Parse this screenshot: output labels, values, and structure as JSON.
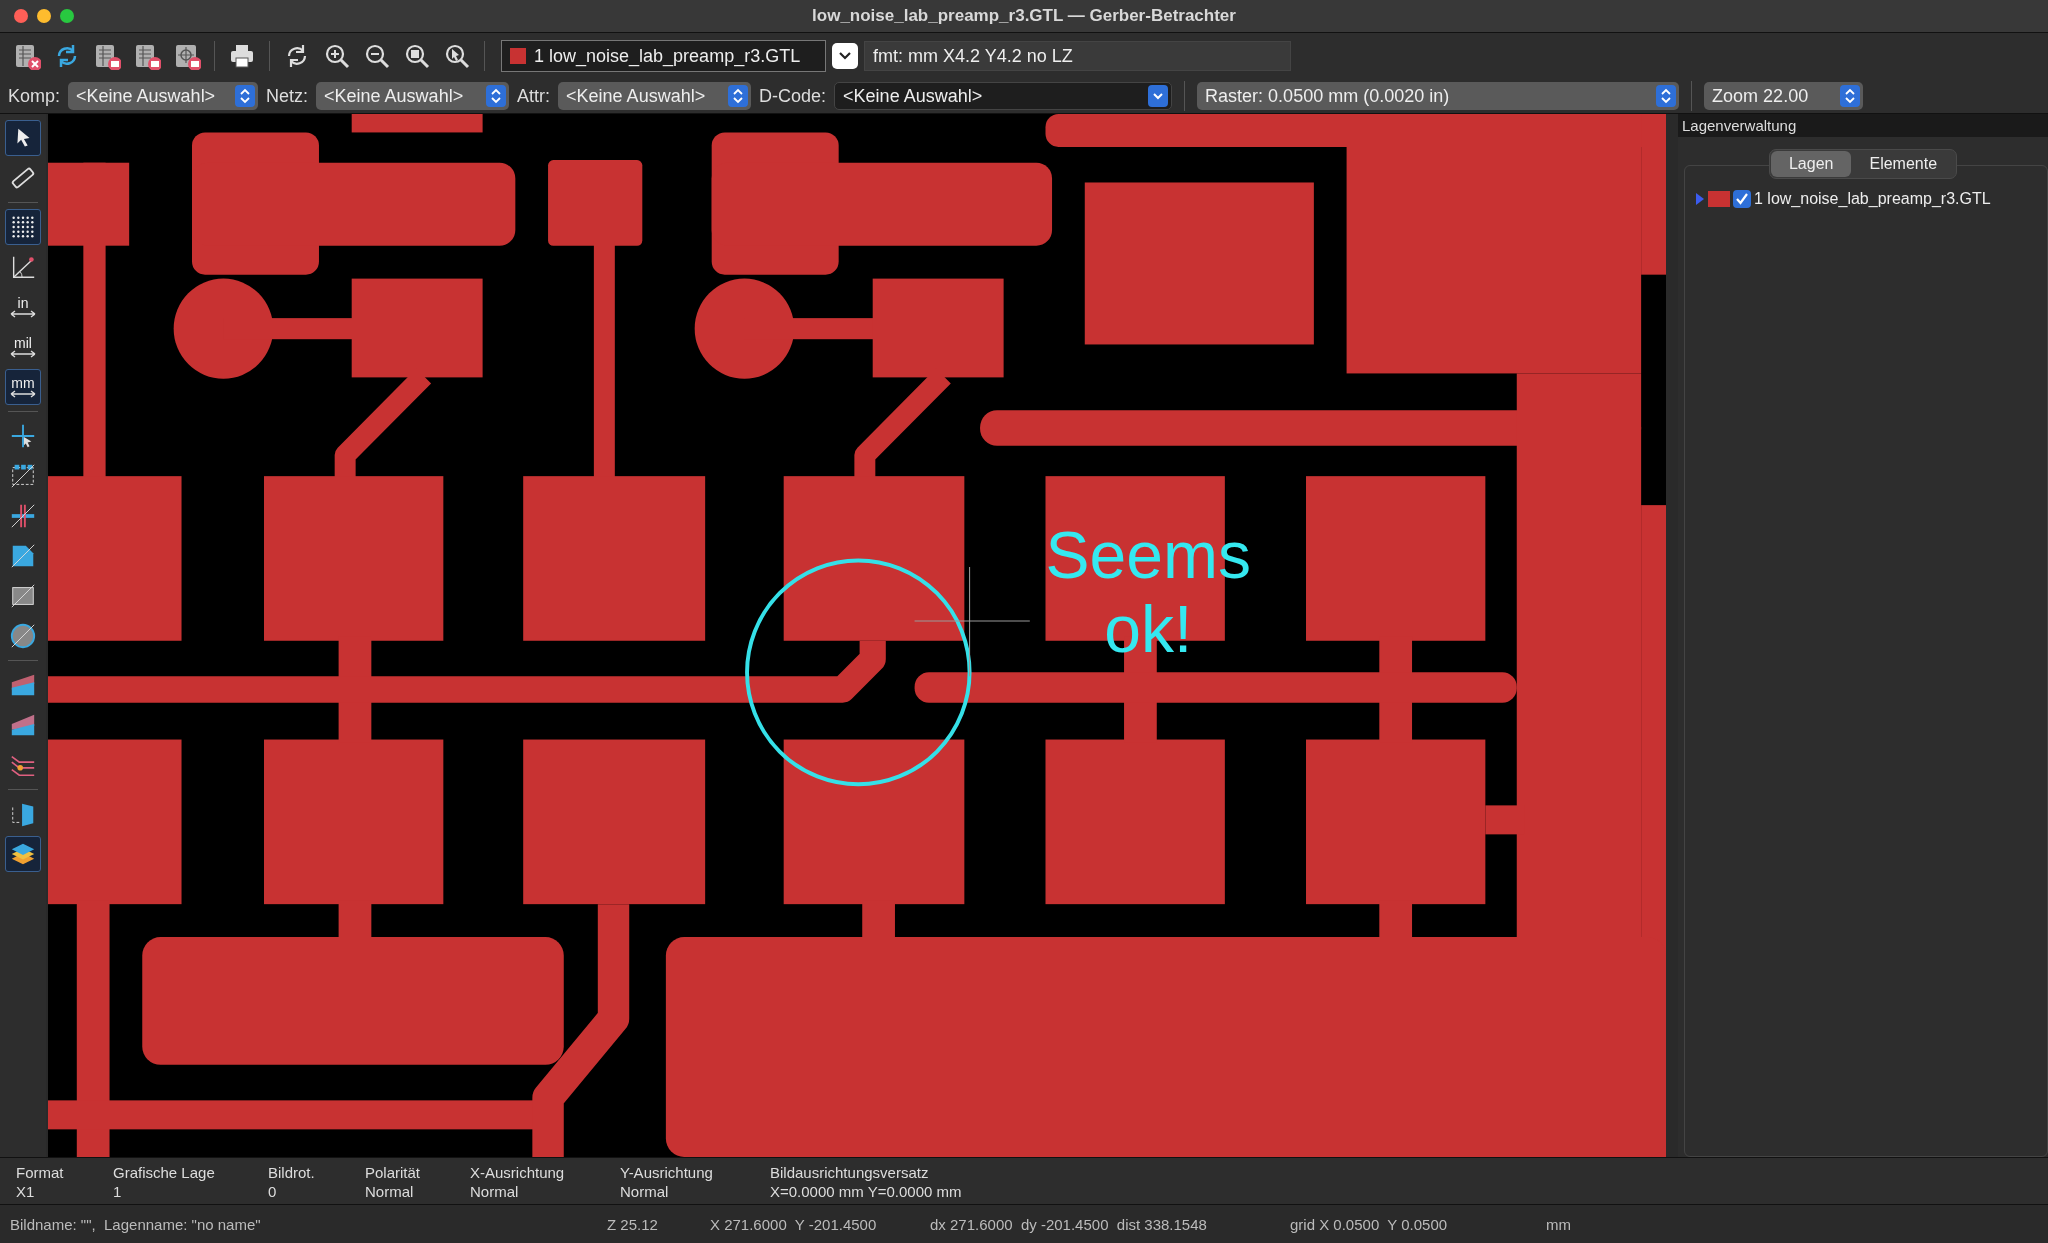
{
  "window": {
    "title": "low_noise_lab_preamp_r3.GTL — Gerber-Betrachter"
  },
  "toolbar": {
    "layer_select": "1 low_noise_lab_preamp_r3.GTL",
    "format": "fmt: mm X4.2 Y4.2 no LZ"
  },
  "filters": [
    {
      "label": "Komp:",
      "value": "<Keine Auswahl>"
    },
    {
      "label": "Netz:",
      "value": "<Keine Auswahl>"
    },
    {
      "label": "Attr:",
      "value": "<Keine Auswahl>"
    },
    {
      "label": "D-Code:",
      "value": "<Keine Auswahl>"
    }
  ],
  "grid_select": "Raster: 0.0500 mm (0.0020 in)",
  "zoom_select": "Zoom 22.00",
  "left_tools": [
    {
      "kind": "select",
      "selected": true
    },
    {
      "kind": "measure",
      "selected": false
    },
    {
      "kind": "grid",
      "selected": true
    },
    {
      "kind": "polar",
      "selected": false
    },
    {
      "kind": "unit",
      "label": "in",
      "selected": false
    },
    {
      "kind": "unit",
      "label": "mil",
      "selected": false
    },
    {
      "kind": "unit",
      "label": "mm",
      "selected": true
    },
    {
      "kind": "cursor",
      "selected": false
    },
    {
      "kind": "flashed",
      "selected": false
    },
    {
      "kind": "lines",
      "selected": false
    },
    {
      "kind": "polygons",
      "selected": false
    },
    {
      "kind": "negative",
      "selected": false
    },
    {
      "kind": "dcodes",
      "selected": false
    },
    {
      "kind": "layers-a",
      "selected": false
    },
    {
      "kind": "layers-b",
      "selected": false
    },
    {
      "kind": "nets",
      "selected": false
    },
    {
      "kind": "flip",
      "selected": false
    },
    {
      "kind": "panel",
      "selected": true
    }
  ],
  "canvas": {
    "annotation": "Seems ok!"
  },
  "layer_panel": {
    "title": "Lagenverwaltung",
    "tabs": [
      {
        "label": "Lagen",
        "selected": true
      },
      {
        "label": "Elemente",
        "selected": false
      }
    ],
    "layers": [
      {
        "name": "1 low_noise_lab_preamp_r3.GTL",
        "color": "#c83232",
        "visible": true,
        "active": true
      }
    ]
  },
  "info": [
    {
      "header": "Format",
      "value": "X1"
    },
    {
      "header": "Grafische Lage",
      "value": "1"
    },
    {
      "header": "Bildrot.",
      "value": "0"
    },
    {
      "header": "Polarität",
      "value": "Normal"
    },
    {
      "header": "X-Ausrichtung",
      "value": "Normal"
    },
    {
      "header": "Y-Ausrichtung",
      "value": "Normal"
    },
    {
      "header": "Bildausrichtungsversatz",
      "value": "X=0.0000 mm Y=0.0000 mm"
    }
  ],
  "status_bar": [
    "Bildname: \"\",  Lagenname: \"no name\"",
    "Z 25.12",
    "X 271.6000  Y -201.4500",
    "dx 271.6000  dy -201.4500  dist 338.1548",
    "grid X 0.0500  Y 0.0500",
    "mm"
  ]
}
